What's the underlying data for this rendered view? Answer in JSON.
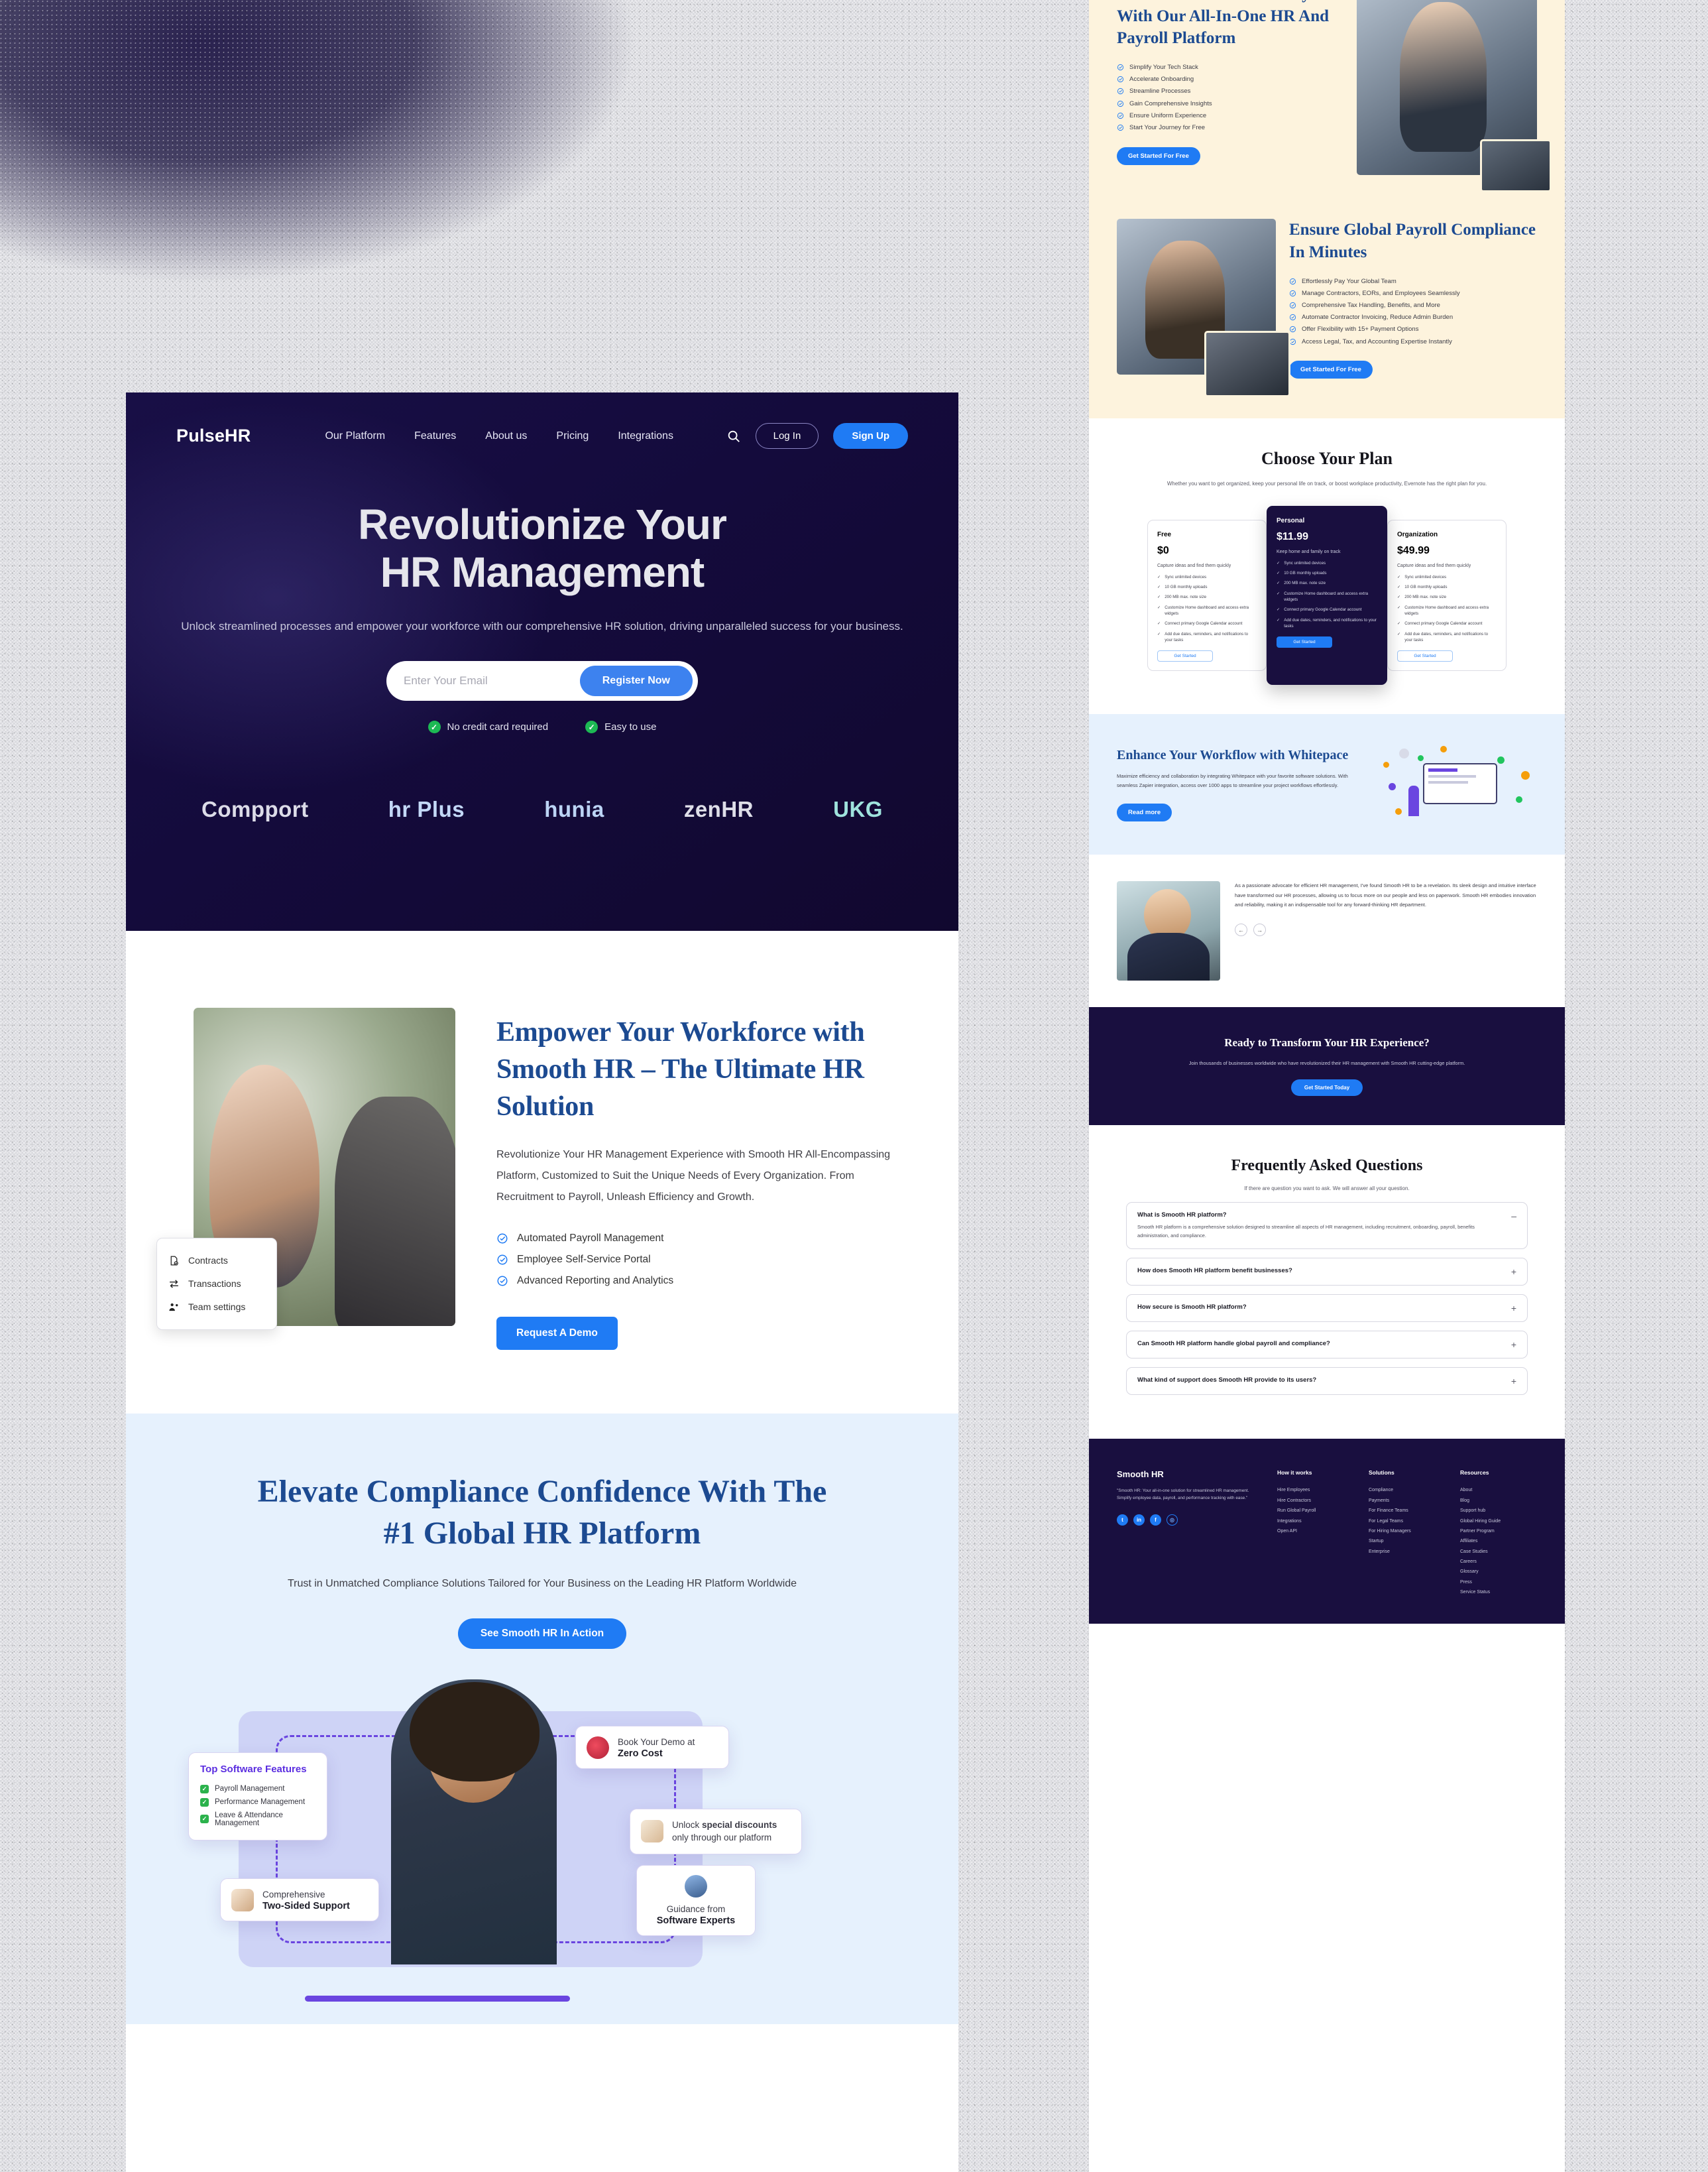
{
  "nav": {
    "logo": "PulseHR",
    "links": [
      "Our Platform",
      "Features",
      "About us",
      "Pricing",
      "Integrations"
    ],
    "login": "Log In",
    "signup": "Sign Up"
  },
  "hero": {
    "title_line1": "Revolutionize Your",
    "title_line2": "HR Management",
    "subtitle": "Unlock streamlined processes and empower your workforce with our comprehensive HR solution, driving unparalleled success for your business.",
    "email_placeholder": "Enter Your Email",
    "email_value": "",
    "register_label": "Register Now",
    "badges": [
      "No credit card required",
      "Easy to use"
    ],
    "logos": [
      "Compport",
      "hr Plus",
      "hunia",
      "zenHR",
      "UKG"
    ]
  },
  "empower": {
    "heading": "Empower Your Workforce with Smooth HR – The Ultimate HR Solution",
    "paragraph": "Revolutionize Your HR Management Experience with Smooth HR All-Encompassing Platform, Customized to Suit the Unique Needs of Every Organization. From Recruitment to Payroll, Unleash Efficiency and Growth.",
    "features": [
      "Automated Payroll Management",
      "Employee Self-Service Portal",
      "Advanced Reporting and Analytics"
    ],
    "cta": "Request A Demo",
    "float_card": [
      "Contracts",
      "Transactions",
      "Team settings"
    ]
  },
  "compliance": {
    "heading_line1": "Elevate Compliance Confidence With The",
    "heading_line2": "#1 Global HR Platform",
    "paragraph": "Trust in Unmatched Compliance Solutions Tailored for Your Business on the Leading HR Platform Worldwide",
    "cta": "See Smooth HR In Action",
    "cards": {
      "features_title": "Top Software Features",
      "features": [
        "Payroll Management",
        "Performance Management",
        "Leave & Attendance Management"
      ],
      "demo_line1": "Book Your Demo at",
      "demo_line2": "Zero Cost",
      "discount_line1_pre": "Unlock ",
      "discount_line1_bold": "special discounts",
      "discount_line2": "only through our platform",
      "support_line1": "Comprehensive",
      "support_line2": "Two-Sided Support",
      "experts_line1": "Guidance from",
      "experts_line2": "Software Experts"
    }
  },
  "unlock": {
    "heading": "Unlock Seamless Efficiency With Our All-In-One HR And Payroll Platform",
    "items": [
      "Simplify Your Tech Stack",
      "Accelerate Onboarding",
      "Streamline Processes",
      "Gain Comprehensive Insights",
      "Ensure Uniform Experience",
      "Start Your Journey for Free"
    ],
    "cta": "Get Started For Free"
  },
  "global_payroll": {
    "heading": "Ensure Global Payroll Compliance In Minutes",
    "items": [
      "Effortlessly Pay Your Global Team",
      "Manage Contractors, EORs, and Employees Seamlessly",
      "Comprehensive Tax Handling, Benefits, and More",
      "Automate Contractor Invoicing, Reduce Admin Burden",
      "Offer Flexibility with 15+ Payment Options",
      "Access Legal, Tax, and Accounting Expertise Instantly"
    ],
    "cta": "Get Started For Free"
  },
  "pricing": {
    "heading": "Choose Your Plan",
    "subtitle": "Whether you want to get organized, keep your personal life on track, or boost workplace productivity, Evernote has the right plan for you.",
    "plans": [
      {
        "name": "Free",
        "price": "$0",
        "desc": "Capture ideas and find them quickly",
        "features": [
          "Sync unlimited devices",
          "10 GB monthly uploads",
          "200 MB max. note size",
          "Customize Home dashboard and access extra widgets",
          "Connect primary Google Calendar account",
          "Add due dates, reminders, and notifications to your tasks"
        ],
        "button": "Get Started"
      },
      {
        "name": "Personal",
        "price": "$11.99",
        "desc": "Keep home and family on track",
        "features": [
          "Sync unlimited devices",
          "10 GB monthly uploads",
          "200 MB max. note size",
          "Customize Home dashboard and access extra widgets",
          "Connect primary Google Calendar account",
          "Add due dates, reminders, and notifications to your tasks"
        ],
        "button": "Get Started"
      },
      {
        "name": "Organization",
        "price": "$49.99",
        "desc": "Capture ideas and find them quickly",
        "features": [
          "Sync unlimited devices",
          "10 GB monthly uploads",
          "200 MB max. note size",
          "Customize Home dashboard and access extra widgets",
          "Connect primary Google Calendar account",
          "Add due dates, reminders, and notifications to your tasks"
        ],
        "button": "Get Started"
      }
    ]
  },
  "whitepace": {
    "heading": "Enhance Your Workflow with Whitepace",
    "paragraph": "Maximize efficiency and collaboration by integrating Whitepace with your favorite software solutions. With seamless Zapier integration, access over 1000 apps to streamline your project workflows effortlessly.",
    "cta": "Read more"
  },
  "testimonial": {
    "quote": "As a passionate advocate for efficient HR management, I've found Smooth HR to be a revelation. Its sleek design and intuitive interface have transformed our HR processes, allowing us to focus more on our people and less on paperwork. Smooth HR embodies innovation and reliability, making it an indispensable tool for any forward-thinking HR department.",
    "prev": "←",
    "next": "→"
  },
  "cta_band": {
    "heading": "Ready to Transform Your HR Experience?",
    "paragraph": "Join thousands of businesses worldwide who have revolutionized their HR management with Smooth HR cutting-edge platform.",
    "button": "Get Started Today"
  },
  "faq": {
    "heading": "Frequently Asked Questions",
    "subtitle": "If there are question you want to ask. We will answer all your question.",
    "items": [
      {
        "q": "What is Smooth HR platform?",
        "a": "Smooth HR platform is a comprehensive solution designed to streamline all aspects of HR management, including recruitment, onboarding, payroll, benefits administration, and compliance.",
        "sign": "–",
        "open": true
      },
      {
        "q": "How does Smooth HR platform benefit businesses?",
        "a": "",
        "sign": "+",
        "open": false
      },
      {
        "q": "How secure is Smooth HR platform?",
        "a": "",
        "sign": "+",
        "open": false
      },
      {
        "q": "Can Smooth HR platform handle global payroll and compliance?",
        "a": "",
        "sign": "+",
        "open": false
      },
      {
        "q": "What kind of support does Smooth HR provide to its users?",
        "a": "",
        "sign": "+",
        "open": false
      }
    ]
  },
  "footer": {
    "brand": "Smooth HR",
    "description": "\"Smooth HR: Your all-in-one solution for streamlined HR management. Simplify employee data, payroll, and performance tracking with ease.\"",
    "socials": [
      "twitter-icon",
      "linkedin-icon",
      "facebook-icon",
      "instagram-icon"
    ],
    "columns": [
      {
        "title": "How it works",
        "links": [
          "Hire Employees",
          "Hire Contractors",
          "Run Global Payroll",
          "Integrations",
          "Open API"
        ]
      },
      {
        "title": "Solutions",
        "links": [
          "Compliance",
          "Payments",
          "For Finance Teams",
          "For Legal Teams",
          "For Hiring Managers",
          "Startup",
          "Enterprise"
        ]
      },
      {
        "title": "Resources",
        "links": [
          "About",
          "Blog",
          "Support hub",
          "Global Hiring Guide",
          "Partner Program",
          "Affiliates",
          "Case Studies",
          "Careers",
          "Glossary",
          "Press",
          "Service Status"
        ]
      }
    ]
  },
  "colors": {
    "accent_blue": "#1f7bf4",
    "deep_navy": "#190f3f",
    "heading_blue": "#1c4a91",
    "cream": "#fdf3dd",
    "light_blue": "#e6f1fd",
    "purple": "#5b2ee0",
    "green": "#2bb24c"
  }
}
